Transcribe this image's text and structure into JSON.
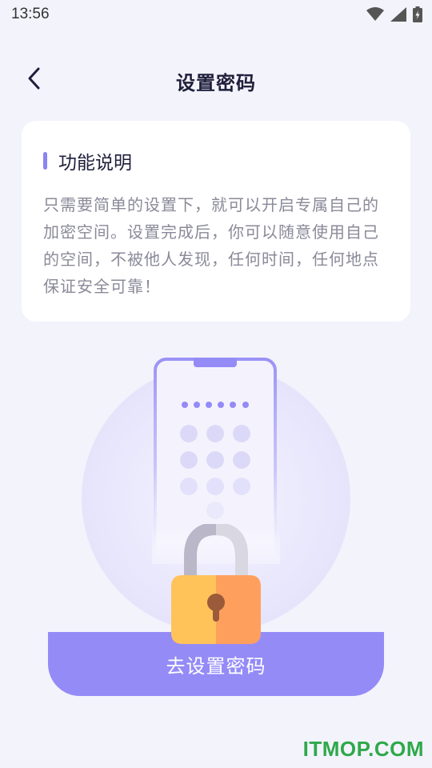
{
  "status_bar": {
    "time": "13:56"
  },
  "header": {
    "title": "设置密码"
  },
  "info_card": {
    "title": "功能说明",
    "body": "只需要简单的设置下，就可以开启专属自己的加密空间。设置完成后，你可以随意使用自己的空间，不被他人发现，任何时间，任何地点保证安全可靠！"
  },
  "cta": {
    "label": "去设置密码"
  },
  "watermark": {
    "text": "ITMOP.COM"
  },
  "colors": {
    "accent": "#948bf7",
    "background": "#f3f3fc",
    "lock_left": "#ffc35a",
    "lock_right": "#ff9f5e",
    "watermark": "#2ea94a"
  }
}
